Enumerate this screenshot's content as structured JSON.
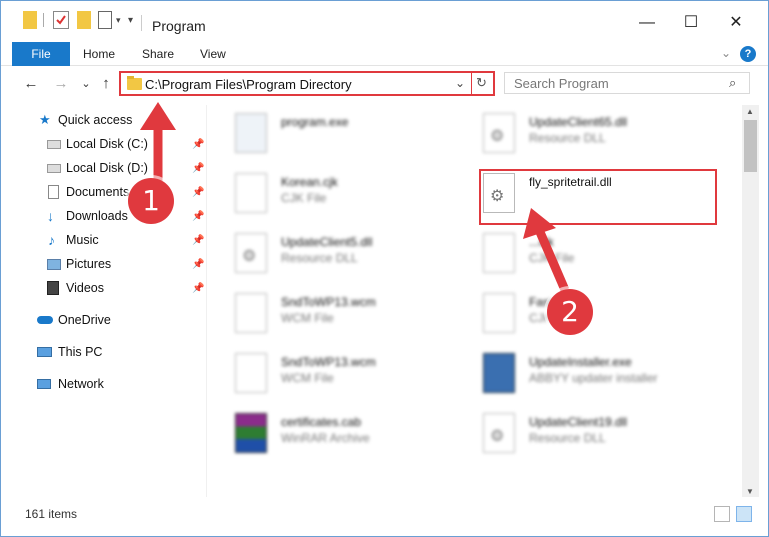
{
  "window": {
    "title": "Program",
    "minimize": "—",
    "maximize": "☐",
    "close": "✕"
  },
  "ribbon": {
    "tabs": [
      "File",
      "Home",
      "Share",
      "View"
    ],
    "expand": "⌄",
    "help": "?"
  },
  "address": {
    "path": "C:\\Program Files\\Program Directory",
    "dropdown": "⌄",
    "refresh": "↻",
    "back": "←",
    "forward": "→",
    "recent": "⌄",
    "up": "↑"
  },
  "search": {
    "placeholder": "Search Program",
    "icon": "⌕"
  },
  "sidebar": {
    "items": [
      {
        "label": "Quick access",
        "icon": "star-icon",
        "pinned": false
      },
      {
        "label": "Local Disk (C:)",
        "icon": "drive-icon",
        "pinned": true
      },
      {
        "label": "Local Disk (D:)",
        "icon": "drive-icon",
        "pinned": true
      },
      {
        "label": "Documents",
        "icon": "documents-icon",
        "pinned": true
      },
      {
        "label": "Downloads",
        "icon": "downloads-icon",
        "pinned": true
      },
      {
        "label": "Music",
        "icon": "music-icon",
        "pinned": true
      },
      {
        "label": "Pictures",
        "icon": "pictures-icon",
        "pinned": true
      },
      {
        "label": "Videos",
        "icon": "videos-icon",
        "pinned": true
      },
      {
        "label": "OneDrive",
        "icon": "cloud-icon",
        "pinned": false
      },
      {
        "label": "This PC",
        "icon": "pc-icon",
        "pinned": false,
        "selected": true
      },
      {
        "label": "Network",
        "icon": "network-icon",
        "pinned": false
      }
    ],
    "pin_glyph": "📌"
  },
  "files": [
    {
      "name": "program.exe",
      "type": "",
      "icon": "exe-icon"
    },
    {
      "name": "UpdateClient65.dll",
      "type": "Resource DLL",
      "icon": "dll-icon"
    },
    {
      "name": "Korean.cjk",
      "type": "CJK File",
      "icon": "file-icon"
    },
    {
      "name": "fly_spritetrail.dll",
      "type": "",
      "icon": "dll-icon"
    },
    {
      "name": "UpdateClient5.dll",
      "type": "Resource DLL",
      "icon": "dll-icon"
    },
    {
      "name": "...cjk",
      "type": "CJK File",
      "icon": "file-icon"
    },
    {
      "name": "SndToWP13.wcm",
      "type": "WCM File",
      "icon": "file-icon"
    },
    {
      "name": "Fast....cjk",
      "type": "CJK File",
      "icon": "file-icon"
    },
    {
      "name": "SndToWP13.wcm",
      "type": "WCM File",
      "icon": "file-icon"
    },
    {
      "name": "UpdateInstaller.exe",
      "type": "ABBYY updater installer",
      "icon": "installer-icon"
    },
    {
      "name": "certificates.cab",
      "type": "WinRAR Archive",
      "icon": "archive-icon"
    },
    {
      "name": "UpdateClient19.dll",
      "type": "Resource DLL",
      "icon": "dll-icon"
    }
  ],
  "status": {
    "count": "161 items"
  },
  "annotations": {
    "step1": "1",
    "step2": "2",
    "color": "#e0393e"
  }
}
